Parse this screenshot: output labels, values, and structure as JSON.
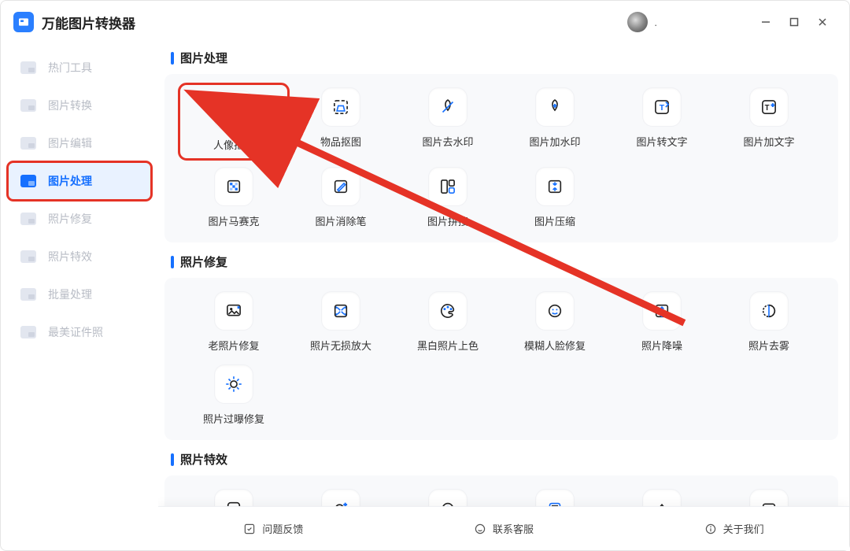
{
  "app": {
    "title": "万能图片转换器",
    "avatar_label": "."
  },
  "window_controls": {
    "min": "minimize",
    "max": "maximize",
    "close": "close"
  },
  "sidebar": {
    "items": [
      {
        "label": "热门工具"
      },
      {
        "label": "图片转换"
      },
      {
        "label": "图片编辑"
      },
      {
        "label": "图片处理",
        "active": true
      },
      {
        "label": "照片修复"
      },
      {
        "label": "照片特效"
      },
      {
        "label": "批量处理"
      },
      {
        "label": "最美证件照"
      }
    ]
  },
  "sections": {
    "s1": {
      "title": "图片处理",
      "tools": [
        {
          "label": "人像抠图",
          "icon": "portrait-cutout-icon",
          "highlight": true
        },
        {
          "label": "物品抠图",
          "icon": "object-cutout-icon"
        },
        {
          "label": "图片去水印",
          "icon": "remove-watermark-icon"
        },
        {
          "label": "图片加水印",
          "icon": "add-watermark-icon"
        },
        {
          "label": "图片转文字",
          "icon": "ocr-icon"
        },
        {
          "label": "图片加文字",
          "icon": "add-text-icon"
        },
        {
          "label": "图片马赛克",
          "icon": "mosaic-icon"
        },
        {
          "label": "图片消除笔",
          "icon": "eraser-pen-icon"
        },
        {
          "label": "图片拼接",
          "icon": "collage-icon"
        },
        {
          "label": "图片压缩",
          "icon": "compress-icon"
        }
      ]
    },
    "s2": {
      "title": "照片修复",
      "tools": [
        {
          "label": "老照片修复",
          "icon": "restore-old-icon"
        },
        {
          "label": "照片无损放大",
          "icon": "upscale-icon"
        },
        {
          "label": "黑白照片上色",
          "icon": "colorize-icon"
        },
        {
          "label": "模糊人脸修复",
          "icon": "face-restore-icon"
        },
        {
          "label": "照片降噪",
          "icon": "denoise-icon"
        },
        {
          "label": "照片去雾",
          "icon": "dehaze-icon"
        },
        {
          "label": "照片过曝修复",
          "icon": "exposure-fix-icon"
        }
      ]
    },
    "s3": {
      "title": "照片特效",
      "tools": [
        {
          "label": "",
          "icon": "effect-1-icon"
        },
        {
          "label": "",
          "icon": "effect-2-icon"
        },
        {
          "label": "",
          "icon": "effect-3-icon"
        },
        {
          "label": "",
          "icon": "effect-4-icon"
        },
        {
          "label": "",
          "icon": "effect-5-icon"
        },
        {
          "label": "",
          "icon": "effect-6-icon"
        }
      ]
    }
  },
  "footer": {
    "feedback": "问题反馈",
    "support": "联系客服",
    "about": "关于我们"
  },
  "annotation": {
    "highlight_target": "人像抠图",
    "highlight_sidebar": "图片处理"
  }
}
